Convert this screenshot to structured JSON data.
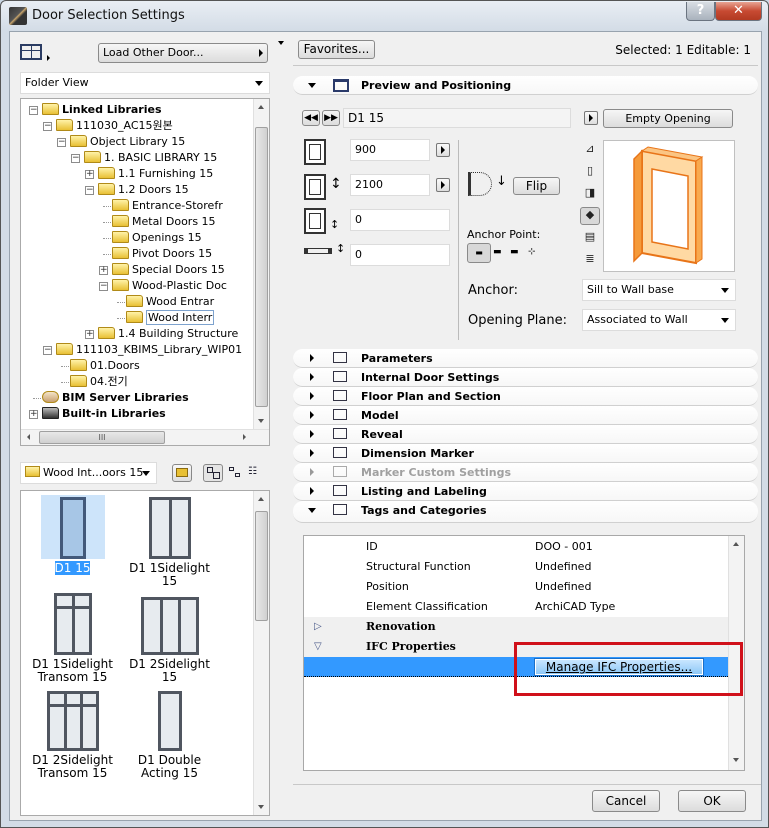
{
  "window": {
    "title": "Door Selection Settings",
    "help_label": "?",
    "close_label": "✕"
  },
  "left": {
    "load_button": "Load Other Door...",
    "folder_view": "Folder View",
    "tree": [
      {
        "label": "Linked Libraries",
        "bold": true,
        "level": 0,
        "expander": "minus",
        "icon": "library"
      },
      {
        "label": "111030_AC15원본",
        "level": 1,
        "expander": "minus",
        "icon": "folder"
      },
      {
        "label": "Object Library 15",
        "level": 2,
        "expander": "minus",
        "icon": "folder"
      },
      {
        "label": "1. BASIC LIBRARY 15",
        "level": 3,
        "expander": "minus",
        "icon": "folder"
      },
      {
        "label": "1.1 Furnishing 15",
        "level": 4,
        "expander": "plus",
        "icon": "folder"
      },
      {
        "label": "1.2 Doors 15",
        "level": 4,
        "expander": "minus",
        "icon": "folder"
      },
      {
        "label": "Entrance-Storefr",
        "level": 5,
        "expander": "",
        "icon": "folder"
      },
      {
        "label": "Metal Doors 15",
        "level": 5,
        "expander": "",
        "icon": "folder"
      },
      {
        "label": "Openings 15",
        "level": 5,
        "expander": "",
        "icon": "folder"
      },
      {
        "label": "Pivot Doors 15",
        "level": 5,
        "expander": "",
        "icon": "folder"
      },
      {
        "label": "Special Doors 15",
        "level": 5,
        "expander": "plus",
        "icon": "folder"
      },
      {
        "label": "Wood-Plastic Doc",
        "level": 5,
        "expander": "minus",
        "icon": "folder"
      },
      {
        "label": "Wood Entrar",
        "level": 6,
        "expander": "",
        "icon": "folder"
      },
      {
        "label": "Wood Interr",
        "level": 6,
        "expander": "",
        "icon": "folder",
        "selected": true
      },
      {
        "label": "1.4 Building Structure",
        "level": 4,
        "expander": "plus",
        "icon": "folder"
      },
      {
        "label": "111103_KBIMS_Library_WIP01",
        "level": 1,
        "expander": "minus",
        "icon": "folder"
      },
      {
        "label": "01.Doors",
        "level": 2,
        "expander": "",
        "icon": "folder"
      },
      {
        "label": "04.전기",
        "level": 2,
        "expander": "",
        "icon": "folder"
      },
      {
        "label": "BIM Server Libraries",
        "bold": true,
        "level": 0,
        "expander": "",
        "icon": "server"
      },
      {
        "label": "Built-in Libraries",
        "bold": true,
        "level": 0,
        "expander": "plus",
        "icon": "builtin"
      }
    ],
    "hscroll_grip": "III",
    "current_folder": "Wood Int...oors 15",
    "items": [
      {
        "name": "D1 15",
        "selected": true,
        "type": "single"
      },
      {
        "name": "D1 1Sidelight 15",
        "type": "sidelight1"
      },
      {
        "name": "D1 1Sidelight Transom 15",
        "type": "sidelight1-transom"
      },
      {
        "name": "D1 2Sidelight 15",
        "type": "sidelight2"
      },
      {
        "name": "D1 2Sidelight Transom 15",
        "type": "sidelight2-transom"
      },
      {
        "name": "D1 Double Acting 15",
        "type": "double-acting"
      }
    ]
  },
  "right": {
    "favorites_button": "Favorites...",
    "selection_status": "Selected: 1 Editable: 1",
    "preview_panel": {
      "title": "Preview and Positioning",
      "object_name": "D1 15",
      "empty_opening_button": "Empty Opening",
      "width": "900",
      "height": "2100",
      "sill_height": "0",
      "offset": "0",
      "flip_button": "Flip",
      "anchor_point_label": "Anchor Point:",
      "anchor_label": "Anchor:",
      "anchor_value": "Sill to Wall base",
      "opening_plane_label": "Opening Plane:",
      "opening_plane_value": "Associated to Wall"
    },
    "panels": [
      {
        "title": "Parameters",
        "enabled": true
      },
      {
        "title": "Internal Door Settings",
        "enabled": true
      },
      {
        "title": "Floor Plan and Section",
        "enabled": true
      },
      {
        "title": "Model",
        "enabled": true
      },
      {
        "title": "Reveal",
        "enabled": true
      },
      {
        "title": "Dimension Marker",
        "enabled": true
      },
      {
        "title": "Marker Custom Settings",
        "enabled": false
      },
      {
        "title": "Listing and Labeling",
        "enabled": true
      },
      {
        "title": "Tags and Categories",
        "enabled": true,
        "expanded": true
      }
    ],
    "tags": {
      "rows": [
        {
          "key": "ID",
          "value": "DOO - 001"
        },
        {
          "key": "Structural Function",
          "value": "Undefined"
        },
        {
          "key": "Position",
          "value": "Undefined"
        },
        {
          "key": "Element Classification",
          "value": "ArchiCAD Type"
        }
      ],
      "groups": [
        {
          "label": "Renovation",
          "expanded": false
        },
        {
          "label": "IFC Properties",
          "expanded": true
        }
      ],
      "manage_ifc_button": "Manage IFC Properties..."
    },
    "cancel_button": "Cancel",
    "ok_button": "OK",
    "highlight_color": "#d0101a",
    "selection_color": "#3399ff"
  }
}
